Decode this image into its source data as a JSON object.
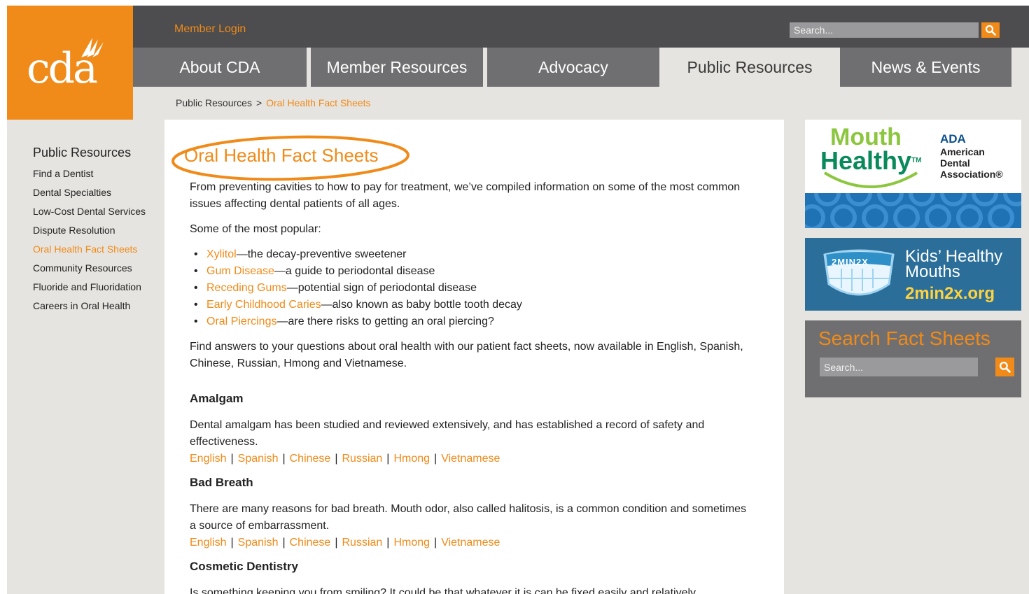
{
  "logo": {
    "text": "cda",
    "reg": "."
  },
  "header": {
    "member_login": "Member Login",
    "search_placeholder": "Search..."
  },
  "nav": {
    "tabs": [
      {
        "label": "About CDA"
      },
      {
        "label": "Member Resources"
      },
      {
        "label": "Advocacy"
      },
      {
        "label": "Public Resources",
        "active": true
      },
      {
        "label": "News & Events"
      }
    ]
  },
  "breadcrumb": {
    "parent": "Public Resources",
    "separator": ">",
    "current": "Oral Health Fact Sheets"
  },
  "sidebar": {
    "heading": "Public Resources",
    "items": [
      {
        "label": "Find a Dentist"
      },
      {
        "label": "Dental Specialties"
      },
      {
        "label": "Low-Cost Dental Services"
      },
      {
        "label": "Dispute Resolution"
      },
      {
        "label": "Oral Health Fact Sheets",
        "active": true
      },
      {
        "label": "Community Resources"
      },
      {
        "label": "Fluoride and Fluoridation"
      },
      {
        "label": "Careers in Oral Health"
      }
    ]
  },
  "main": {
    "title": "Oral Health Fact Sheets",
    "intro": "From preventing cavities to how to pay for treatment, we’ve compiled information on some of the most common issues affecting dental patients of all ages.",
    "popular_label": "Some of the most popular:",
    "popular": [
      {
        "link": "Xylitol",
        "desc": "—the decay-preventive sweetener"
      },
      {
        "link": "Gum Disease",
        "desc": "—a guide to periodontal disease"
      },
      {
        "link": "Receding Gums",
        "desc": "—potential sign of periodontal disease"
      },
      {
        "link": "Early Childhood Caries",
        "desc": "—also known as baby bottle tooth decay"
      },
      {
        "link": "Oral Piercings",
        "desc": "—are there risks to getting an oral piercing?"
      }
    ],
    "answers": "Find answers to your questions about oral health with our patient fact sheets, now available in English, Spanish, Chinese, Russian, Hmong and Vietnamese.",
    "languages": [
      "English",
      "Spanish",
      "Chinese",
      "Russian",
      "Hmong",
      "Vietnamese"
    ],
    "lang_separator": "|",
    "sections": [
      {
        "heading": "Amalgam",
        "text": "Dental amalgam has been studied and reviewed extensively, and has established a record of safety and effectiveness."
      },
      {
        "heading": "Bad Breath",
        "text": "There are many reasons for bad breath. Mouth odor, also called halitosis, is a common condition and sometimes a source of embarrassment."
      },
      {
        "heading": "Cosmetic Dentistry",
        "text": "Is something keeping you from smiling? It could be that whatever it is can be fixed easily and relatively"
      }
    ]
  },
  "right": {
    "mouth_healthy": {
      "word1": "Mouth",
      "word2": "Healthy",
      "tm": "TM",
      "abbr": "ADA",
      "full_line1": "American",
      "full_line2": "Dental",
      "full_line3": "Association®"
    },
    "kids": {
      "badge": "2MIN2X",
      "line1": "Kids’ Healthy",
      "line2": "Mouths",
      "url": "2min2x.org"
    },
    "search": {
      "heading": "Search Fact Sheets",
      "placeholder": "Search..."
    }
  },
  "colors": {
    "accent": "#f08a18",
    "nav": "#6f6f71",
    "topbar": "#4d4d4f",
    "page_bg": "#e6e4e0"
  }
}
